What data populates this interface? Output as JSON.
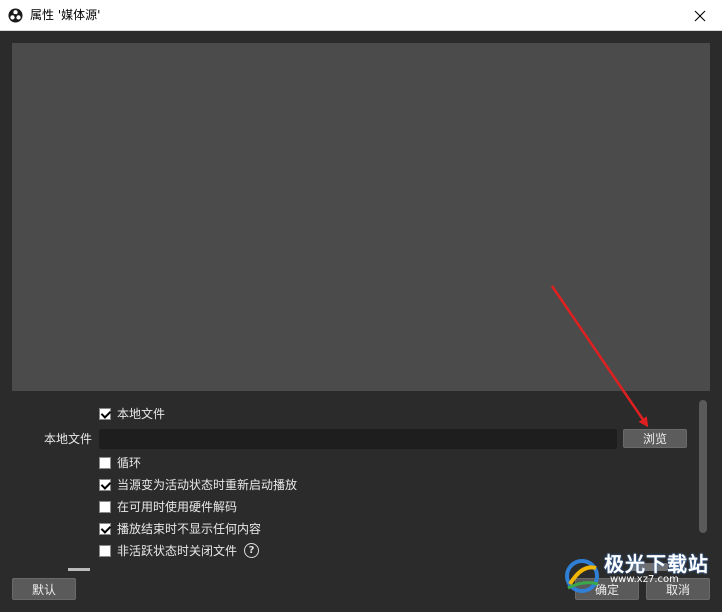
{
  "window": {
    "title": "属性 '媒体源'"
  },
  "properties": {
    "local_file_checkbox": {
      "label": "本地文件",
      "checked": true
    },
    "local_file_field_label": "本地文件",
    "local_file_value": "",
    "browse_label": "浏览",
    "loop": {
      "label": "循环",
      "checked": false
    },
    "restart_on_activate": {
      "label": "当源变为活动状态时重新启动播放",
      "checked": true
    },
    "hw_decode": {
      "label": "在可用时使用硬件解码",
      "checked": false
    },
    "show_nothing_on_end": {
      "label": "播放结束时不显示任何内容",
      "checked": true
    },
    "close_when_inactive": {
      "label": "非活跃状态时关闭文件",
      "checked": false
    },
    "help_glyph": "?"
  },
  "footer": {
    "default_label": "默认",
    "ok_label": "确定",
    "cancel_label": "取消"
  },
  "watermark": {
    "text": "极光下载站",
    "url": "www.xz7.com"
  },
  "colors": {
    "annotation_arrow": "#e02020",
    "preview_bg": "#4b4b4b",
    "dialog_bg": "#2b2b2b"
  },
  "icons": {
    "title_logo": "obs-logo-icon",
    "close": "close-icon",
    "help": "help-circle-icon"
  }
}
